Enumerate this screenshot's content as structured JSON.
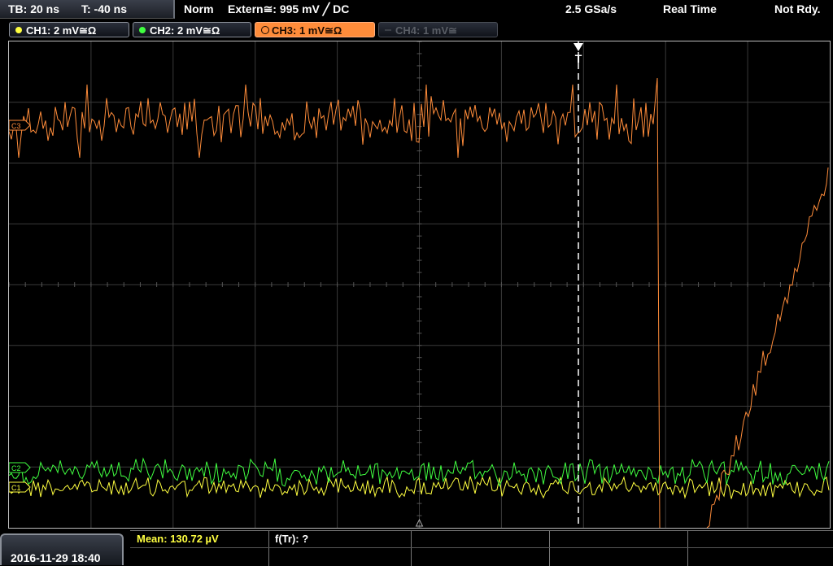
{
  "topbar": {
    "timebase": "TB: 20 ns",
    "trigger_time": "T: -40 ns",
    "trigger_mode": "Norm",
    "trigger_source": "Extern≅: 995 mV ╱ DC",
    "sample_rate": "2.5 GSa/s",
    "acquisition_mode": "Real Time",
    "status": "Not Rdy."
  },
  "channels": [
    {
      "label": "CH1: 2 mV≅Ω",
      "color": "#ffff40",
      "state": "on"
    },
    {
      "label": "CH2: 2 mV≅Ω",
      "color": "#40ff40",
      "state": "on"
    },
    {
      "label": "CH3: 1 mV≅Ω",
      "color": "#ff8c3a",
      "state": "active"
    },
    {
      "label": "CH4: 1 mV≅",
      "color": "#5a5e66",
      "state": "off"
    }
  ],
  "markers": {
    "ch3": "C3",
    "ch2": "C2",
    "ch1": "C1",
    "trigger": "T"
  },
  "measurements": {
    "mean": "Mean: 130.72 µV",
    "freq": "f(Tr): ?"
  },
  "datetime": "2016-11-29 18:40",
  "colors": {
    "ch1": "#ffff40",
    "ch2": "#40ff40",
    "ch3": "#ff8c3a",
    "grid": "#3a3a3a",
    "background": "#000000"
  }
}
